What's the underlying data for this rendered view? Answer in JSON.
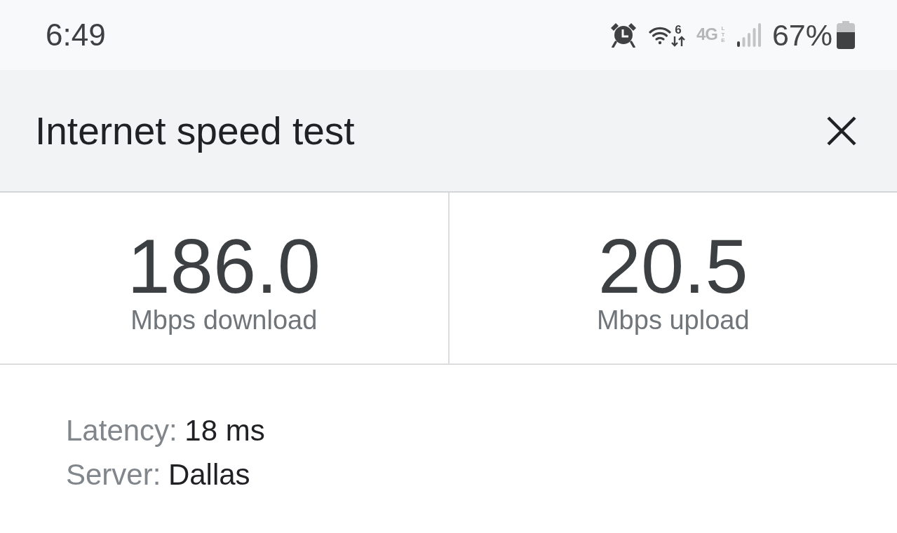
{
  "status_bar": {
    "time": "6:49",
    "wifi_generation": "6",
    "network_type": "4G",
    "network_subtype": "LTE",
    "battery_percent": "67%"
  },
  "dialog": {
    "title": "Internet speed test"
  },
  "results": [
    {
      "value": "186.0",
      "label": "Mbps download"
    },
    {
      "value": "20.5",
      "label": "Mbps upload"
    }
  ],
  "details": [
    {
      "label": "Latency:",
      "value": "18 ms"
    },
    {
      "label": "Server:",
      "value": "Dallas"
    }
  ]
}
